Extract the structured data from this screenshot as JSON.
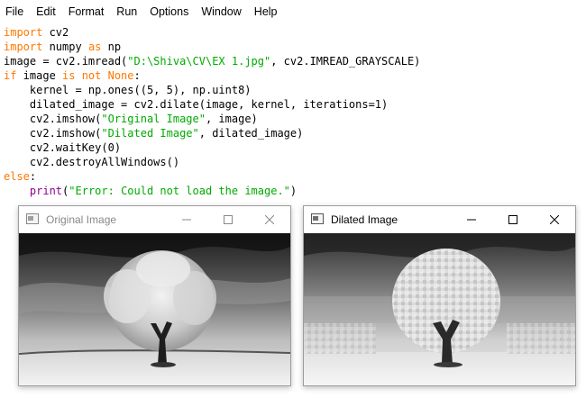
{
  "menu": [
    "File",
    "Edit",
    "Format",
    "Run",
    "Options",
    "Window",
    "Help"
  ],
  "code": {
    "kw_import": "import",
    "kw_as": "as",
    "kw_if": "if",
    "kw_is_not_none": "is not None",
    "kw_else": "else",
    "bi_print": "print",
    "l1_rest": " cv2",
    "l2_rest": " numpy ",
    "l2_np": " np",
    "l3_a": "image = cv2.imread(",
    "l3_str": "\"D:\\Shiva\\CV\\EX 1.jpg\"",
    "l3_b": ", cv2.IMREAD_GRAYSCALE)",
    "l4_a": " image ",
    "l4_b": ":",
    "l5": "    kernel = np.ones((5, 5), np.uint8)",
    "l6": "    dilated_image = cv2.dilate(image, kernel, iterations=1)",
    "l7_a": "    cv2.imshow(",
    "l7_str": "\"Original Image\"",
    "l7_b": ", image)",
    "l8_a": "    cv2.imshow(",
    "l8_str": "\"Dilated Image\"",
    "l8_b": ", dilated_image)",
    "l9": "    cv2.waitKey(0)",
    "l10": "    cv2.destroyAllWindows()",
    "l11_b": ":",
    "l12_indent": "    ",
    "l12_a": "(",
    "l12_str": "\"Error: Could not load the image.\"",
    "l12_b": ")"
  },
  "windows": {
    "original": {
      "title": "Original Image"
    },
    "dilated": {
      "title": "Dilated Image"
    }
  },
  "colors": {
    "keyword": "#ff7700",
    "string": "#00aa00",
    "builtin": "#900090"
  }
}
